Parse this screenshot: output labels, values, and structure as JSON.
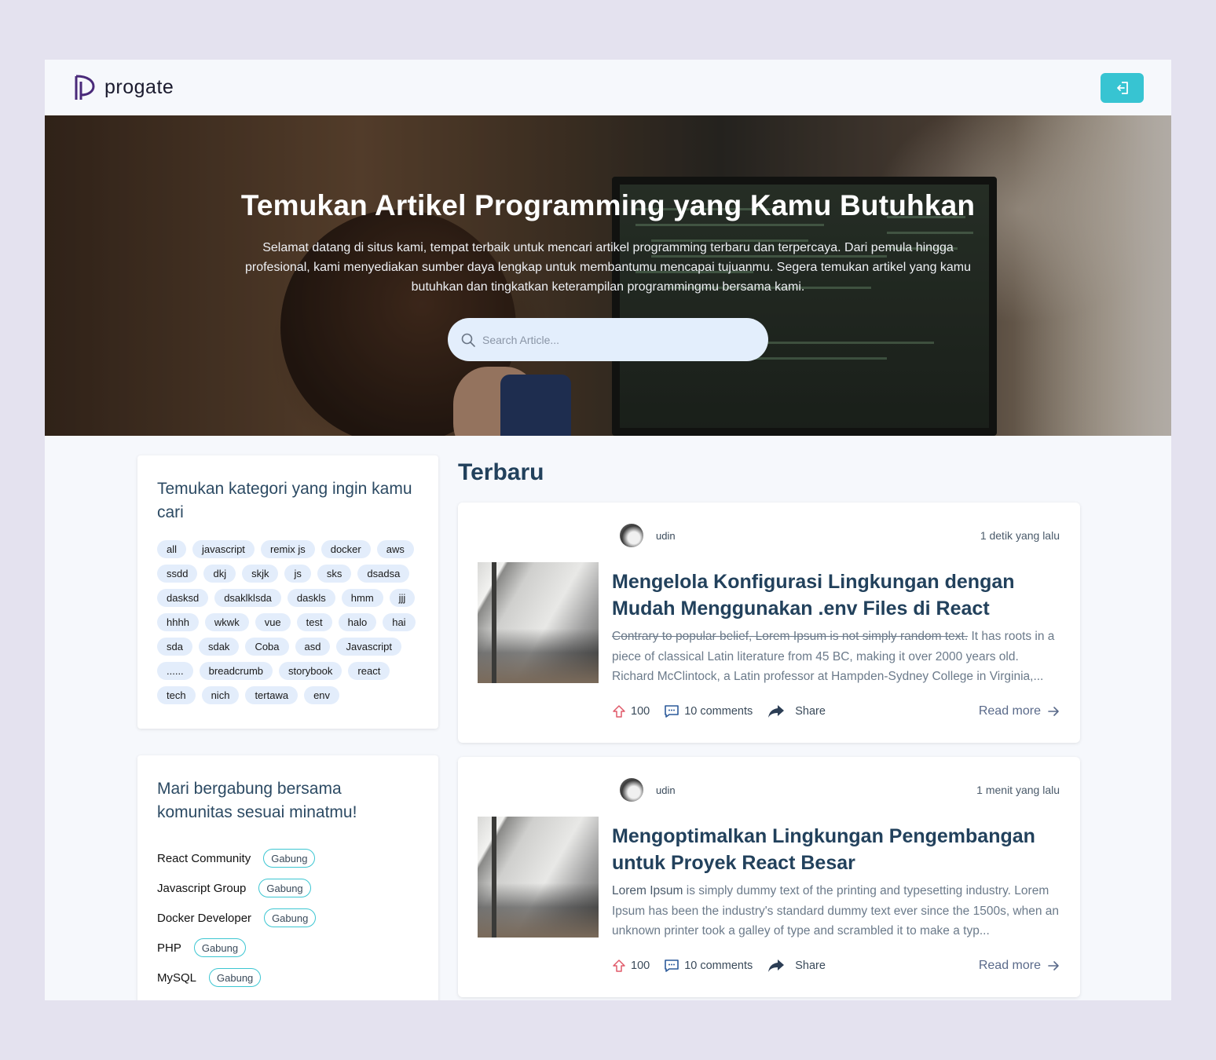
{
  "brand": {
    "name": "progate",
    "accent": "#37c4d2",
    "logo_color": "#4a2a7a"
  },
  "header": {
    "login_icon": "login-icon"
  },
  "hero": {
    "title": "Temukan Artikel Programming yang Kamu Butuhkan",
    "description": "Selamat datang di situs kami, tempat terbaik untuk mencari artikel programming terbaru dan terpercaya. Dari pemula hingga profesional, kami menyediakan sumber daya lengkap untuk membantumu mencapai tujuanmu. Segera temukan artikel yang kamu butuhkan dan tingkatkan keterampilan programmingmu bersama kami.",
    "search_placeholder": "Search Article..."
  },
  "categories": {
    "title": "Temukan kategori yang ingin kamu cari",
    "tags": [
      "all",
      "javascript",
      "remix js",
      "docker",
      "aws",
      "ssdd",
      "dkj",
      "skjk",
      "js",
      "sks",
      "dsadsa",
      "dasksd",
      "dsaklklsda",
      "daskls",
      "hmm",
      "jjj",
      "hhhh",
      "wkwk",
      "vue",
      "test",
      "halo",
      "hai",
      "sda",
      "sdak",
      "Coba",
      "asd",
      "Javascript",
      "......",
      "breadcrumb",
      "storybook",
      "react",
      "tech",
      "nich",
      "tertawa",
      "env"
    ]
  },
  "communities": {
    "title": "Mari bergabung bersama komunitas sesuai minatmu!",
    "join_label": "Gabung",
    "items": [
      {
        "name": "React Community"
      },
      {
        "name": "Javascript Group"
      },
      {
        "name": "Docker Developer"
      },
      {
        "name": "PHP"
      },
      {
        "name": "MySQL"
      }
    ]
  },
  "main": {
    "section_title": "Terbaru",
    "articles": [
      {
        "author": "udin",
        "time": "1 detik yang lalu",
        "title": "Mengelola Konfigurasi Lingkungan dengan Mudah Menggunakan .env Files di React",
        "desc_struck": "Contrary to popular belief, Lorem Ipsum is not simply random text.",
        "desc_rest": " It has roots in a piece of classical Latin literature from 45 BC, making it over 2000 years old. Richard McClintock, a Latin professor at Hampden-Sydney College in Virginia,...",
        "upvotes": "100",
        "comments": "10 comments",
        "share": "Share",
        "read_more": "Read more"
      },
      {
        "author": "udin",
        "time": "1 menit yang lalu",
        "title": "Mengoptimalkan Lingkungan Pengembangan untuk Proyek React Besar",
        "desc_highlight": "Lorem Ipsum",
        "desc_rest": " is simply dummy text of the printing and typesetting industry. Lorem Ipsum has been the industry's standard dummy text ever since the 1500s, when an unknown printer took a galley of type and scrambled it to make a typ...",
        "upvotes": "100",
        "comments": "10 comments",
        "share": "Share",
        "read_more": "Read more"
      }
    ]
  }
}
